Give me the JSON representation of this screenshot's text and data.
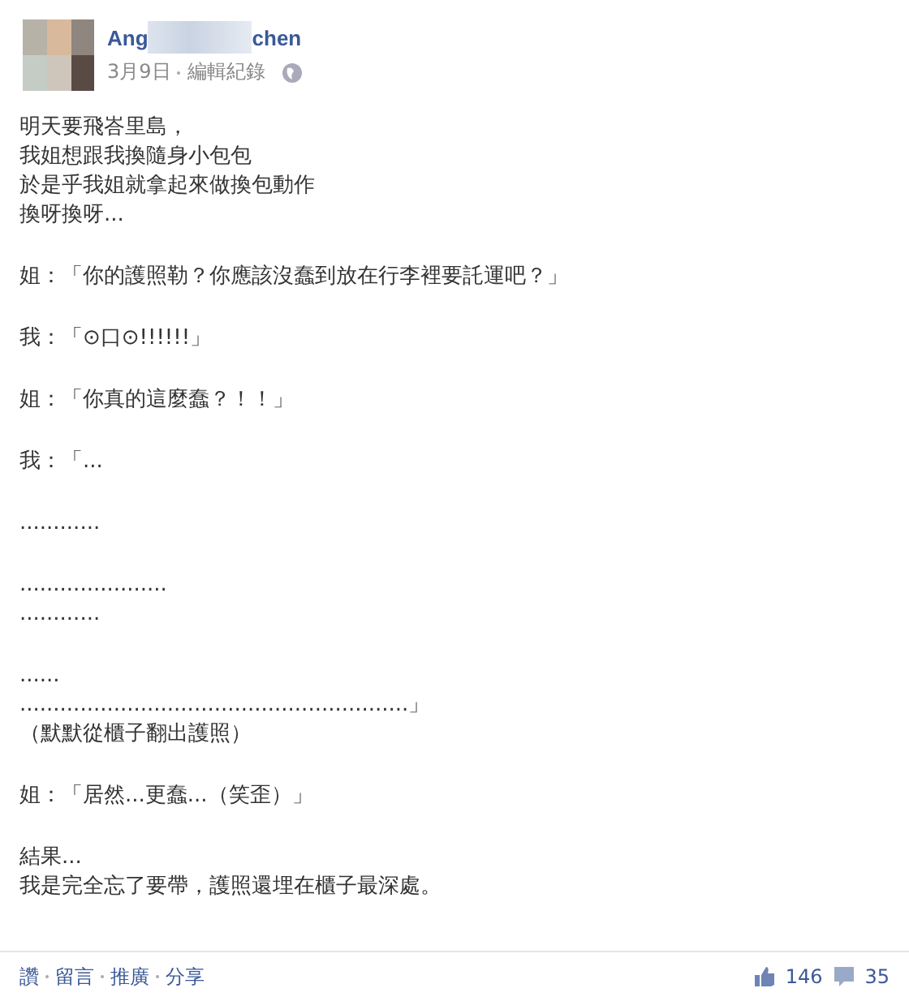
{
  "post": {
    "author_visible_parts": [
      "Ang",
      "chen"
    ],
    "date": "3月9日",
    "edit_link": "編輯紀錄",
    "paragraphs": [
      [
        "明天要飛峇里島，",
        "我姐想跟我換隨身小包包",
        "於是乎我姐就拿起來做換包動作",
        "換呀換呀..."
      ],
      [
        "姐：「你的護照勒？你應該沒蠢到放在行李裡要託運吧？」"
      ],
      [
        "我：「⊙口⊙!!!!!!」"
      ],
      [
        "姐：「你真的這麼蠢？！！」"
      ],
      [
        "我：「..."
      ],
      [
        "............"
      ],
      [
        "......................",
        "............"
      ],
      [
        "......",
        "..........................................................」",
        "（默默從櫃子翻出護照）"
      ],
      [
        "姐：「居然...更蠢...（笑歪）」"
      ],
      [
        "結果...",
        "我是完全忘了要帶，護照還埋在櫃子最深處。"
      ]
    ]
  },
  "actions": [
    "讚",
    "留言",
    "推廣",
    "分享"
  ],
  "likes": "146",
  "comments": "35"
}
